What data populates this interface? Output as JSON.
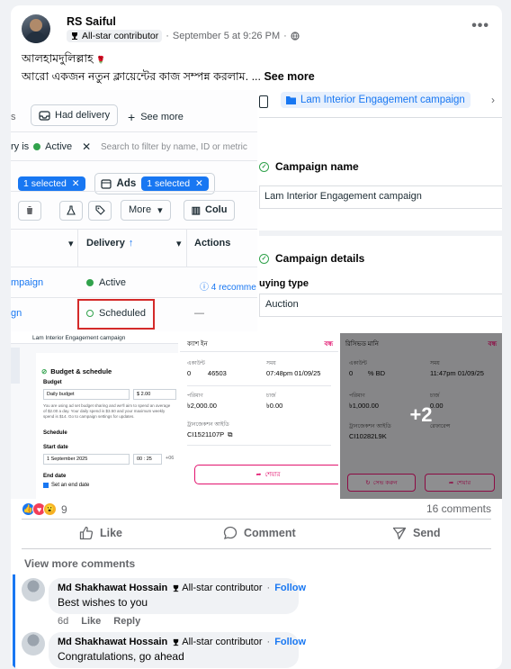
{
  "post": {
    "author": "RS Saiful",
    "badge": "All-star contributor",
    "time": "September 5 at 9:26 PM",
    "sep": "·",
    "line1": "আলহামদুলিল্লাহ",
    "line2": "আরো একজন নতুন ক্লায়েন্টের কাজ সম্পন্ন করলাম.",
    "ellipsis": "...",
    "see_more": "See more",
    "more_menu": "•••"
  },
  "shot1": {
    "tab_s": "s",
    "had_delivery": "Had delivery",
    "see_more": "See more",
    "filter_chip": "ry is",
    "filter_status": "Active",
    "filter_close": "✕",
    "search_placeholder": "Search to filter by name, ID or metric",
    "selected_a": "1 selected",
    "ads_label": "Ads",
    "selected_b": "1 selected",
    "more_btn": "More",
    "columns_btn": "Colu",
    "col_delivery": "Delivery",
    "col_actions": "Actions",
    "row1_name": "mpaign",
    "row1_status": "Active",
    "row1_action": "4 recomme",
    "row2_name": "gn",
    "row2_status": "Scheduled",
    "row2_action": "—"
  },
  "shot2": {
    "breadcrumb": "Lam Interior Engagement campaign",
    "campaign_name_heading": "Campaign name",
    "campaign_name_value": "Lam Interior Engagement campaign",
    "campaign_details_heading": "Campaign details",
    "buying_type_label": "uying type",
    "buying_type_value": "Auction"
  },
  "shot3": {
    "breadcrumb": "Lam Interior Engagement campaign",
    "section": "Budget & schedule",
    "budget_label": "Budget",
    "budget_type": "Daily budget",
    "budget_value": "$ 2.00",
    "note": "You are using ad set budget sharing and we'll aim to spend an average of $2.00 a day. Your daily spend is $3.50 and your maximum weekly spend is $14. Go to campaign settings for updates.",
    "schedule": "Schedule",
    "start_date_label": "Start date",
    "start_date": "1 September 2025",
    "start_time": "00 : 25",
    "tz": "+06",
    "end_date_label": "End date",
    "end_check": "Set an end date"
  },
  "shot4": {
    "title": "ক্যাশ ইন",
    "close": "বন্ধ",
    "col1_label": "একাউন্ট",
    "col1_value": "0         46503",
    "col2_label": "সময়",
    "col2_value": "07:48pm 01/09/25",
    "amount_label": "পরিমাণ",
    "amount_value": "৳2,000.00",
    "fee_label": "চার্জ",
    "fee_value": "৳0.00",
    "trx_label": "ট্রানজেকশন আইডি",
    "trx_value": "CI1521107P",
    "share_btn": "শেয়ার"
  },
  "shot5": {
    "title": "রিসিভড মানি",
    "close": "বন্ধ",
    "col1_label": "একাউন্ট",
    "col1_value": "0        % BD",
    "col2_label": "সময়",
    "col2_value": "11:47pm 01/09/25",
    "amount_label": "পরিমাণ",
    "amount_value": "৳1,000.00",
    "fee_label": "চার্জ",
    "fee_value": "0.00",
    "trx_label": "ট্রানজেকশন আইডি",
    "trx_value": "CI10282L9K",
    "ref_label": "রেফারেন্স",
    "save_btn": "সেভ করুন",
    "share_btn": "শেয়ার",
    "more_count": "+2"
  },
  "reactions": {
    "count": "9",
    "comments": "16 comments"
  },
  "actions": {
    "like": "Like",
    "comment": "Comment",
    "send": "Send"
  },
  "comments": {
    "view_more": "View more comments",
    "items": [
      {
        "author": "Md Shakhawat Hossain",
        "badge": "All-star contributor",
        "follow": "Follow",
        "text": "Best wishes to you",
        "age": "6d",
        "like": "Like",
        "reply": "Reply"
      },
      {
        "author": "Md Shakhawat Hossain",
        "badge": "All-star contributor",
        "follow": "Follow",
        "text": "Congratulations, go ahead"
      }
    ]
  },
  "colors": {
    "accent": "#1877f2",
    "bkash": "#e2136e",
    "scheduled_box": "#d42a2a",
    "active_dot": "#31a24c"
  }
}
